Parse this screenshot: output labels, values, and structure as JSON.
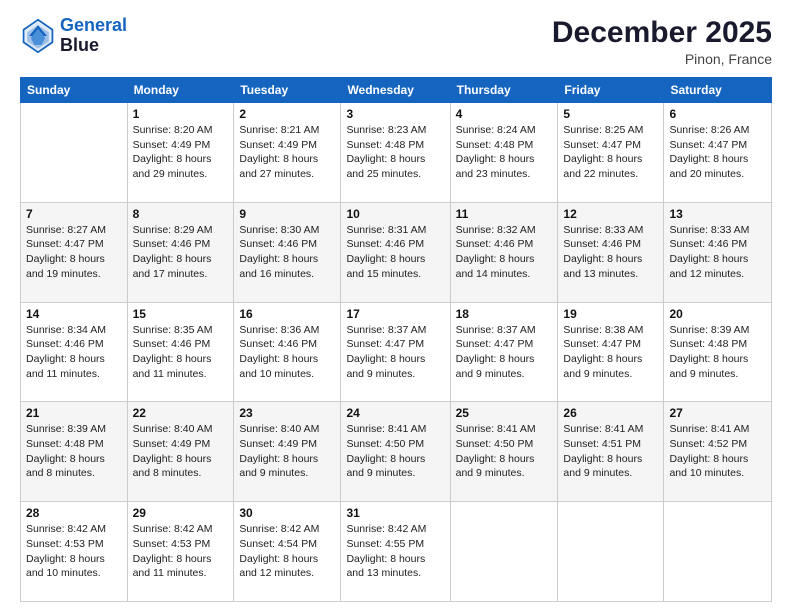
{
  "logo": {
    "line1": "General",
    "line2": "Blue"
  },
  "header": {
    "month_year": "December 2025",
    "location": "Pinon, France"
  },
  "weekdays": [
    "Sunday",
    "Monday",
    "Tuesday",
    "Wednesday",
    "Thursday",
    "Friday",
    "Saturday"
  ],
  "weeks": [
    [
      {
        "day": "",
        "sunrise": "",
        "sunset": "",
        "daylight": ""
      },
      {
        "day": "1",
        "sunrise": "Sunrise: 8:20 AM",
        "sunset": "Sunset: 4:49 PM",
        "daylight": "Daylight: 8 hours and 29 minutes."
      },
      {
        "day": "2",
        "sunrise": "Sunrise: 8:21 AM",
        "sunset": "Sunset: 4:49 PM",
        "daylight": "Daylight: 8 hours and 27 minutes."
      },
      {
        "day": "3",
        "sunrise": "Sunrise: 8:23 AM",
        "sunset": "Sunset: 4:48 PM",
        "daylight": "Daylight: 8 hours and 25 minutes."
      },
      {
        "day": "4",
        "sunrise": "Sunrise: 8:24 AM",
        "sunset": "Sunset: 4:48 PM",
        "daylight": "Daylight: 8 hours and 23 minutes."
      },
      {
        "day": "5",
        "sunrise": "Sunrise: 8:25 AM",
        "sunset": "Sunset: 4:47 PM",
        "daylight": "Daylight: 8 hours and 22 minutes."
      },
      {
        "day": "6",
        "sunrise": "Sunrise: 8:26 AM",
        "sunset": "Sunset: 4:47 PM",
        "daylight": "Daylight: 8 hours and 20 minutes."
      }
    ],
    [
      {
        "day": "7",
        "sunrise": "Sunrise: 8:27 AM",
        "sunset": "Sunset: 4:47 PM",
        "daylight": "Daylight: 8 hours and 19 minutes."
      },
      {
        "day": "8",
        "sunrise": "Sunrise: 8:29 AM",
        "sunset": "Sunset: 4:46 PM",
        "daylight": "Daylight: 8 hours and 17 minutes."
      },
      {
        "day": "9",
        "sunrise": "Sunrise: 8:30 AM",
        "sunset": "Sunset: 4:46 PM",
        "daylight": "Daylight: 8 hours and 16 minutes."
      },
      {
        "day": "10",
        "sunrise": "Sunrise: 8:31 AM",
        "sunset": "Sunset: 4:46 PM",
        "daylight": "Daylight: 8 hours and 15 minutes."
      },
      {
        "day": "11",
        "sunrise": "Sunrise: 8:32 AM",
        "sunset": "Sunset: 4:46 PM",
        "daylight": "Daylight: 8 hours and 14 minutes."
      },
      {
        "day": "12",
        "sunrise": "Sunrise: 8:33 AM",
        "sunset": "Sunset: 4:46 PM",
        "daylight": "Daylight: 8 hours and 13 minutes."
      },
      {
        "day": "13",
        "sunrise": "Sunrise: 8:33 AM",
        "sunset": "Sunset: 4:46 PM",
        "daylight": "Daylight: 8 hours and 12 minutes."
      }
    ],
    [
      {
        "day": "14",
        "sunrise": "Sunrise: 8:34 AM",
        "sunset": "Sunset: 4:46 PM",
        "daylight": "Daylight: 8 hours and 11 minutes."
      },
      {
        "day": "15",
        "sunrise": "Sunrise: 8:35 AM",
        "sunset": "Sunset: 4:46 PM",
        "daylight": "Daylight: 8 hours and 11 minutes."
      },
      {
        "day": "16",
        "sunrise": "Sunrise: 8:36 AM",
        "sunset": "Sunset: 4:46 PM",
        "daylight": "Daylight: 8 hours and 10 minutes."
      },
      {
        "day": "17",
        "sunrise": "Sunrise: 8:37 AM",
        "sunset": "Sunset: 4:47 PM",
        "daylight": "Daylight: 8 hours and 9 minutes."
      },
      {
        "day": "18",
        "sunrise": "Sunrise: 8:37 AM",
        "sunset": "Sunset: 4:47 PM",
        "daylight": "Daylight: 8 hours and 9 minutes."
      },
      {
        "day": "19",
        "sunrise": "Sunrise: 8:38 AM",
        "sunset": "Sunset: 4:47 PM",
        "daylight": "Daylight: 8 hours and 9 minutes."
      },
      {
        "day": "20",
        "sunrise": "Sunrise: 8:39 AM",
        "sunset": "Sunset: 4:48 PM",
        "daylight": "Daylight: 8 hours and 9 minutes."
      }
    ],
    [
      {
        "day": "21",
        "sunrise": "Sunrise: 8:39 AM",
        "sunset": "Sunset: 4:48 PM",
        "daylight": "Daylight: 8 hours and 8 minutes."
      },
      {
        "day": "22",
        "sunrise": "Sunrise: 8:40 AM",
        "sunset": "Sunset: 4:49 PM",
        "daylight": "Daylight: 8 hours and 8 minutes."
      },
      {
        "day": "23",
        "sunrise": "Sunrise: 8:40 AM",
        "sunset": "Sunset: 4:49 PM",
        "daylight": "Daylight: 8 hours and 9 minutes."
      },
      {
        "day": "24",
        "sunrise": "Sunrise: 8:41 AM",
        "sunset": "Sunset: 4:50 PM",
        "daylight": "Daylight: 8 hours and 9 minutes."
      },
      {
        "day": "25",
        "sunrise": "Sunrise: 8:41 AM",
        "sunset": "Sunset: 4:50 PM",
        "daylight": "Daylight: 8 hours and 9 minutes."
      },
      {
        "day": "26",
        "sunrise": "Sunrise: 8:41 AM",
        "sunset": "Sunset: 4:51 PM",
        "daylight": "Daylight: 8 hours and 9 minutes."
      },
      {
        "day": "27",
        "sunrise": "Sunrise: 8:41 AM",
        "sunset": "Sunset: 4:52 PM",
        "daylight": "Daylight: 8 hours and 10 minutes."
      }
    ],
    [
      {
        "day": "28",
        "sunrise": "Sunrise: 8:42 AM",
        "sunset": "Sunset: 4:53 PM",
        "daylight": "Daylight: 8 hours and 10 minutes."
      },
      {
        "day": "29",
        "sunrise": "Sunrise: 8:42 AM",
        "sunset": "Sunset: 4:53 PM",
        "daylight": "Daylight: 8 hours and 11 minutes."
      },
      {
        "day": "30",
        "sunrise": "Sunrise: 8:42 AM",
        "sunset": "Sunset: 4:54 PM",
        "daylight": "Daylight: 8 hours and 12 minutes."
      },
      {
        "day": "31",
        "sunrise": "Sunrise: 8:42 AM",
        "sunset": "Sunset: 4:55 PM",
        "daylight": "Daylight: 8 hours and 13 minutes."
      },
      {
        "day": "",
        "sunrise": "",
        "sunset": "",
        "daylight": ""
      },
      {
        "day": "",
        "sunrise": "",
        "sunset": "",
        "daylight": ""
      },
      {
        "day": "",
        "sunrise": "",
        "sunset": "",
        "daylight": ""
      }
    ]
  ]
}
